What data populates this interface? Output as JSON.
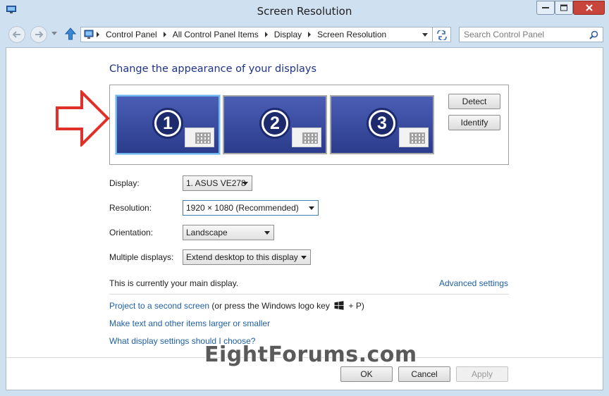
{
  "window": {
    "title": "Screen Resolution",
    "icon": "display-settings-icon"
  },
  "address": {
    "crumbs": [
      "Control Panel",
      "All Control Panel Items",
      "Display",
      "Screen Resolution"
    ],
    "search_placeholder": "Search Control Panel"
  },
  "main": {
    "heading": "Change the appearance of your displays",
    "monitors": [
      {
        "number": "1",
        "selected": true
      },
      {
        "number": "2",
        "selected": false
      },
      {
        "number": "3",
        "selected": false
      }
    ],
    "detect_label": "Detect",
    "identify_label": "Identify",
    "display": {
      "label": "Display:",
      "value": "1. ASUS VE278"
    },
    "resolution": {
      "label": "Resolution:",
      "value": "1920 × 1080 (Recommended)"
    },
    "orientation": {
      "label": "Orientation:",
      "value": "Landscape"
    },
    "multiple": {
      "label": "Multiple displays:",
      "value": "Extend desktop to this display"
    },
    "main_display_text": "This is currently your main display.",
    "advanced_link": "Advanced settings",
    "project_link": "Project to a second screen",
    "project_suffix_before": "(or press the Windows logo key",
    "project_suffix_after": "+ P)",
    "text_size_link": "Make text and other items larger or smaller",
    "help_link": "What display settings should I choose?"
  },
  "buttons": {
    "ok": "OK",
    "cancel": "Cancel",
    "apply": "Apply"
  },
  "watermark": "EightForums.com",
  "colors": {
    "accent_link": "#1f5fa3",
    "heading": "#1e3287",
    "monitor_fill": "#3a4ea3",
    "callout_arrow": "#e0302a"
  }
}
